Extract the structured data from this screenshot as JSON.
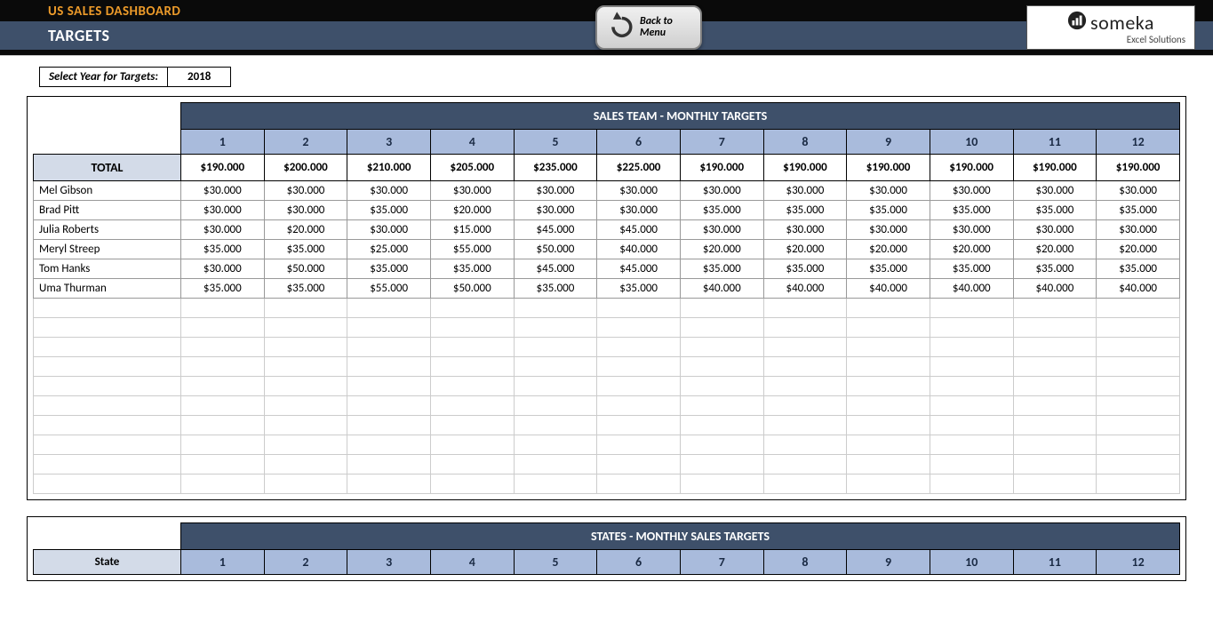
{
  "header": {
    "dashboard_title": "US SALES DASHBOARD",
    "page_title": "TARGETS",
    "back_button": "Back to Menu",
    "logo_main": "someka",
    "logo_sub": "Excel Solutions"
  },
  "year_selector": {
    "label": "Select Year for Targets:",
    "value": "2018"
  },
  "sales_team": {
    "title": "SALES TEAM - MONTHLY TARGETS",
    "months": [
      "1",
      "2",
      "3",
      "4",
      "5",
      "6",
      "7",
      "8",
      "9",
      "10",
      "11",
      "12"
    ],
    "total_label": "TOTAL",
    "totals": [
      "$190.000",
      "$200.000",
      "$210.000",
      "$205.000",
      "$235.000",
      "$225.000",
      "$190.000",
      "$190.000",
      "$190.000",
      "$190.000",
      "$190.000",
      "$190.000"
    ],
    "rows": [
      {
        "name": "Mel Gibson",
        "values": [
          "$30.000",
          "$30.000",
          "$30.000",
          "$30.000",
          "$30.000",
          "$30.000",
          "$30.000",
          "$30.000",
          "$30.000",
          "$30.000",
          "$30.000",
          "$30.000"
        ]
      },
      {
        "name": "Brad Pitt",
        "values": [
          "$30.000",
          "$30.000",
          "$35.000",
          "$20.000",
          "$30.000",
          "$30.000",
          "$35.000",
          "$35.000",
          "$35.000",
          "$35.000",
          "$35.000",
          "$35.000"
        ]
      },
      {
        "name": "Julia Roberts",
        "values": [
          "$30.000",
          "$20.000",
          "$30.000",
          "$15.000",
          "$45.000",
          "$45.000",
          "$30.000",
          "$30.000",
          "$30.000",
          "$30.000",
          "$30.000",
          "$30.000"
        ]
      },
      {
        "name": "Meryl Streep",
        "values": [
          "$35.000",
          "$35.000",
          "$25.000",
          "$55.000",
          "$50.000",
          "$40.000",
          "$20.000",
          "$20.000",
          "$20.000",
          "$20.000",
          "$20.000",
          "$20.000"
        ]
      },
      {
        "name": "Tom Hanks",
        "values": [
          "$30.000",
          "$50.000",
          "$35.000",
          "$35.000",
          "$45.000",
          "$45.000",
          "$35.000",
          "$35.000",
          "$35.000",
          "$35.000",
          "$35.000",
          "$35.000"
        ]
      },
      {
        "name": "Uma Thurman",
        "values": [
          "$35.000",
          "$35.000",
          "$55.000",
          "$50.000",
          "$35.000",
          "$35.000",
          "$40.000",
          "$40.000",
          "$40.000",
          "$40.000",
          "$40.000",
          "$40.000"
        ]
      }
    ],
    "empty_rows": 10
  },
  "states": {
    "title": "STATES - MONTHLY SALES TARGETS",
    "state_label": "State",
    "months": [
      "1",
      "2",
      "3",
      "4",
      "5",
      "6",
      "7",
      "8",
      "9",
      "10",
      "11",
      "12"
    ]
  }
}
